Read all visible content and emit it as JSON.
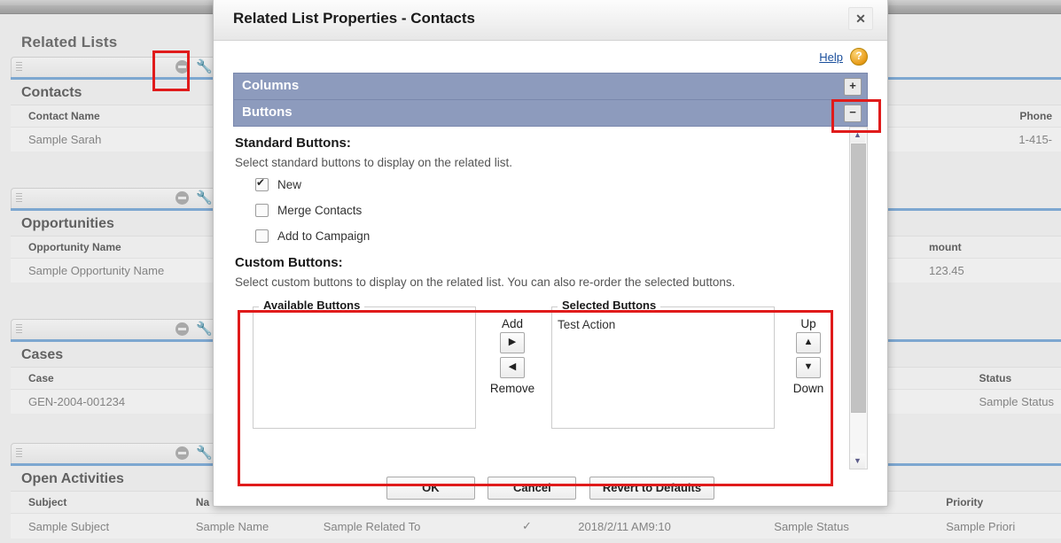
{
  "background": {
    "page_title": "Related Lists",
    "related_lists": [
      {
        "name": "Contacts",
        "columns": [
          "Contact Name",
          "Phone"
        ],
        "row": [
          "Sample Sarah",
          "1-415-"
        ]
      },
      {
        "name": "Opportunities",
        "columns": [
          "Opportunity Name",
          "mount"
        ],
        "row": [
          "Sample Opportunity Name",
          "123.45"
        ]
      },
      {
        "name": "Cases",
        "columns": [
          "Case",
          "Status"
        ],
        "row": [
          "GEN-2004-001234",
          "Sample Status"
        ]
      },
      {
        "name": "Open Activities",
        "columns": [
          "Subject",
          "Na",
          "",
          "",
          "",
          "",
          "Priority"
        ],
        "row": [
          "Sample Subject",
          "Sample Name",
          "Sample Related To",
          "✓",
          "2018/2/11 AM9:10",
          "Sample Status",
          "Sample Priori"
        ]
      }
    ],
    "icons": {
      "minus": "collapse-icon",
      "wrench": "wrench-icon",
      "grip": "drag-handle-icon"
    }
  },
  "dialog": {
    "title": "Related List Properties - Contacts",
    "close_label": "✕",
    "help_label": "Help",
    "help_icon_label": "?",
    "sections": [
      {
        "label": "Columns",
        "toggle": "+",
        "expanded": false
      },
      {
        "label": "Buttons",
        "toggle": "−",
        "expanded": true
      }
    ],
    "standard": {
      "heading": "Standard Buttons:",
      "description": "Select standard buttons to display on the related list.",
      "checkboxes": [
        {
          "label": "New",
          "checked": true
        },
        {
          "label": "Merge Contacts",
          "checked": false
        },
        {
          "label": "Add to Campaign",
          "checked": false
        }
      ]
    },
    "custom": {
      "heading": "Custom Buttons:",
      "description": "Select custom buttons to display on the related list. You can also re-order the selected buttons.",
      "available_legend": "Available Buttons",
      "available_items": [],
      "selected_legend": "Selected Buttons",
      "selected_items": [
        "Test Action"
      ],
      "add_label": "Add",
      "add_arrow": "▶",
      "remove_label": "Remove",
      "remove_arrow": "◀",
      "up_label": "Up",
      "up_arrow": "▲",
      "down_label": "Down",
      "down_arrow": "▼"
    },
    "footer": {
      "ok": "OK",
      "cancel": "Cancel",
      "revert": "Revert to Defaults"
    },
    "scrollbar": {
      "up_arrow": "▲",
      "down_arrow": "▼"
    }
  },
  "annotations": {
    "accent_color": "#e01b1b",
    "boxes": [
      "wrench-icon-highlight",
      "buttons-collapse-toggle-highlight",
      "custom-buttons-picker-highlight"
    ]
  }
}
